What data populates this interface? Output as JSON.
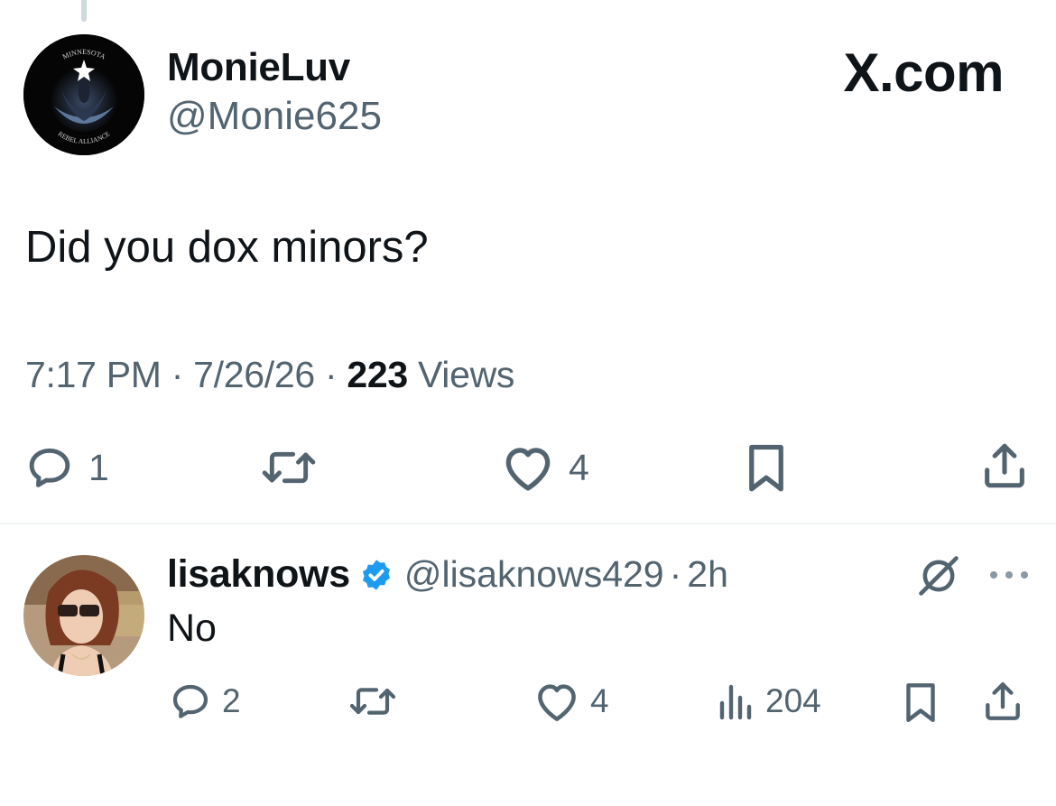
{
  "brand": {
    "label": "X.com"
  },
  "tweet": {
    "display_name": "MonieLuv",
    "handle": "@Monie625",
    "avatar": {
      "top_text": "MINNESOTA",
      "bottom_text": "REBEL ALLIANCE",
      "description": "black circular logo with star and emblem"
    },
    "text": "Did you dox minors?",
    "time": "7:17 PM",
    "sep1": "·",
    "date": "7/26/26",
    "sep2": "·",
    "views_count": "223",
    "views_label": "Views",
    "actions": {
      "reply_count": "1",
      "retweet_count": "",
      "like_count": "4"
    }
  },
  "reply": {
    "display_name": "lisaknows",
    "verified": true,
    "handle": "@lisaknows429",
    "sep": "·",
    "time": "2h",
    "text": "No",
    "actions": {
      "reply_count": "2",
      "like_count": "4",
      "views_count": "204"
    }
  },
  "colors": {
    "text": "#0f1419",
    "secondary": "#536471",
    "verified": "#1d9bf0",
    "divider": "#eff3f4"
  },
  "icons": [
    "reply-icon",
    "retweet-icon",
    "like-icon",
    "bookmark-icon",
    "share-icon",
    "views-icon",
    "grok-icon",
    "more-icon",
    "verified-badge-icon"
  ]
}
